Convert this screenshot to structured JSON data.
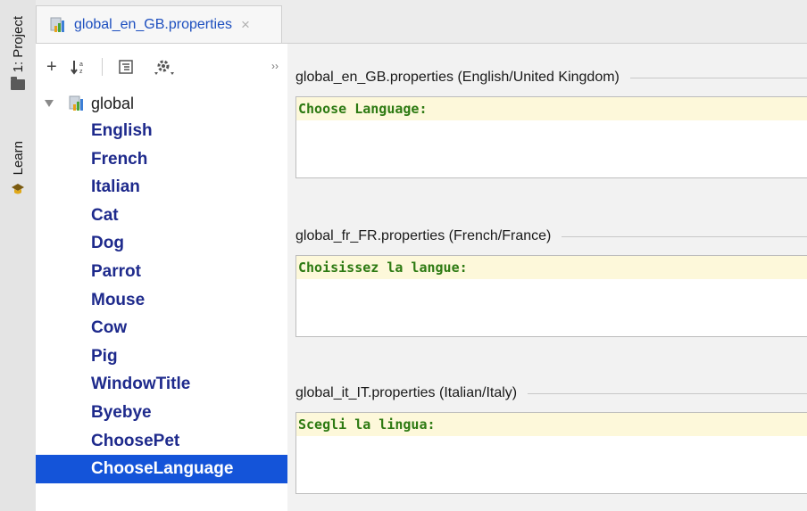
{
  "left_strip": {
    "project_tab": "1: Project",
    "learn_tab": "Learn"
  },
  "tabbar": {
    "active_tab": "global_en_GB.properties"
  },
  "project_panel": {
    "root": "global",
    "keys": [
      "English",
      "French",
      "Italian",
      "Cat",
      "Dog",
      "Parrot",
      "Mouse",
      "Cow",
      "Pig",
      "WindowTitle",
      "Byebye",
      "ChoosePet",
      "ChooseLanguage"
    ],
    "selected_key": "ChooseLanguage"
  },
  "editor": {
    "sections": [
      {
        "header": "global_en_GB.properties (English/United Kingdom)",
        "value": "Choose Language:"
      },
      {
        "header": "global_fr_FR.properties (French/France)",
        "value": "Choisissez la langue:"
      },
      {
        "header": "global_it_IT.properties (Italian/Italy)",
        "value": "Scegli la lingua:"
      }
    ]
  },
  "colors": {
    "selection": "#1454d9",
    "key_text": "#1e2a8c",
    "value_text": "#2d7a12",
    "value_bg": "#fdf8da"
  }
}
